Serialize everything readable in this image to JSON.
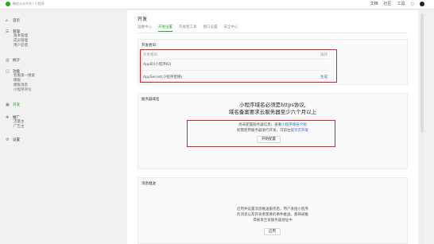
{
  "topbar": {
    "brand": "微信公众平台 | 小程序",
    "links": [
      "文档",
      "社区",
      "工具"
    ],
    "bell": "○"
  },
  "sidebar": {
    "home": {
      "icon": "⌂",
      "label": "首页"
    },
    "manage": {
      "icon": "☰",
      "label": "管理",
      "items": [
        "版本管理",
        "成员管理",
        "用户反馈"
      ]
    },
    "stats": {
      "icon": "▥",
      "label": "统计"
    },
    "features": {
      "icon": "◫",
      "label": "功能",
      "items": [
        "客服第一搜索",
        "模板",
        "模板消息",
        "小程序评论"
      ]
    },
    "dev": {
      "icon": "▣",
      "label": "开发"
    },
    "promo": {
      "icon": "✚",
      "label": "推广",
      "items": [
        "流量主",
        "广告主"
      ]
    },
    "settings": {
      "icon": "⚙",
      "label": "设置"
    }
  },
  "main": {
    "title": "开发",
    "tabs": [
      "运维中心",
      "开发设置",
      "开发者工具",
      "接口设置",
      "安全中心"
    ],
    "active_tab": 1,
    "dev_id_card": {
      "title": "开发者ID",
      "header_left": "开发者ID",
      "header_right": "操作",
      "appid_label": "AppID(小程序ID)",
      "appid_value": "",
      "secret_label": "AppSecret(小程序密钥)",
      "secret_action": "生成"
    },
    "server_card": {
      "title": "服务器域名",
      "note_line1": "小程序域名必须是https协议,",
      "note_line2": "域名备案要求云服务器至少六个月以上",
      "desc_line1": "尚未配置服务器信息，查看",
      "desc_link1": "小程序域名介绍",
      "desc_line2": "如需使用服务器进行开发，可前往",
      "desc_link2": "提示云开发",
      "button": "开始配置"
    },
    "msg_card": {
      "title": "消息推送",
      "desc": [
        "启用并设置消息推送服务后，用户发给小程序",
        "的消息以及开发者需要的事件推送，都将被推",
        "得被发至该服务器地址中"
      ],
      "button": "启用"
    }
  },
  "colors": {
    "accent": "#1aad19",
    "highlight": "#e51c23",
    "link": "#2c6cc7"
  }
}
